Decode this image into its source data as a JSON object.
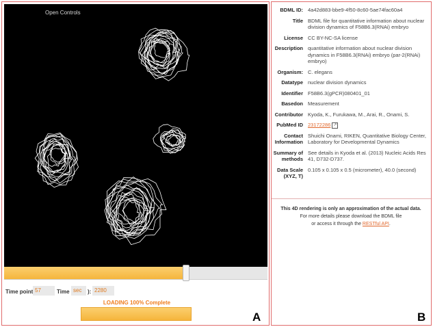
{
  "viewer": {
    "open_controls": "Open Controls",
    "slider_fraction": 0.69
  },
  "timepoint": {
    "label": "Time point:",
    "value": "57",
    "time_label_prefix": "Time (",
    "time_unit": "sec",
    "time_label_suffix": "):",
    "time_value": "2280"
  },
  "loading": {
    "text": "LOADING 100% Complete",
    "fraction": 1.0
  },
  "labels": {
    "panel_a": "A",
    "panel_b": "B"
  },
  "metadata": [
    {
      "key": "BDML ID:",
      "value": "4a42d883-bbe9-4f50-8c60-5ae74fac60a4"
    },
    {
      "key": "Title",
      "value": "BDML file for quantitative information about nuclear division dynamics of F58B6.3(RNAi) embryo"
    },
    {
      "key": "License",
      "value": "CC BY-NC-SA license"
    },
    {
      "key": "Description",
      "value": "quantitative information about nuclear division dynamics in F58B6.3(RNAi) embryo (par-2(RNAi) embryo)"
    },
    {
      "key": "Organism:",
      "value": "C. elegans"
    },
    {
      "key": "Datatype",
      "value": "nuclear division dynamics"
    },
    {
      "key": "Identifier",
      "value": "F58B6.3(gPCR)080401_01"
    },
    {
      "key": "Basedon",
      "value": "Measurement"
    },
    {
      "key": "Contributor",
      "value": "Kyoda, K., Furukawa, M., Arai, R., Onami, S."
    },
    {
      "key": "PubMed ID",
      "value": "23172286"
    },
    {
      "key": "Contact Information",
      "value": "Shuichi Onami, RIKEN, Quantitative Biology Center, Laboratory for Developmental Dynamics"
    },
    {
      "key": "Summary of methods",
      "value": "See details in Kyoda et al. (2013) Nucleic Acids Res 41, D732-D737."
    },
    {
      "key": "Data Scale (XYZ, T)",
      "value": "0.105 x 0.105 x 0.5 (micrometer), 40.0 (second)"
    }
  ],
  "note": {
    "line1": "This 4D rendering is only an approximation of the actual data.",
    "line2": "For more details please download the BDML file",
    "line3_prefix": "or access it through the",
    "line3_link": "RESTful API",
    "line3_suffix": "."
  },
  "colors": {
    "accent": "#e0662a",
    "bar": "#f5b53c",
    "border": "#e06a6a"
  }
}
